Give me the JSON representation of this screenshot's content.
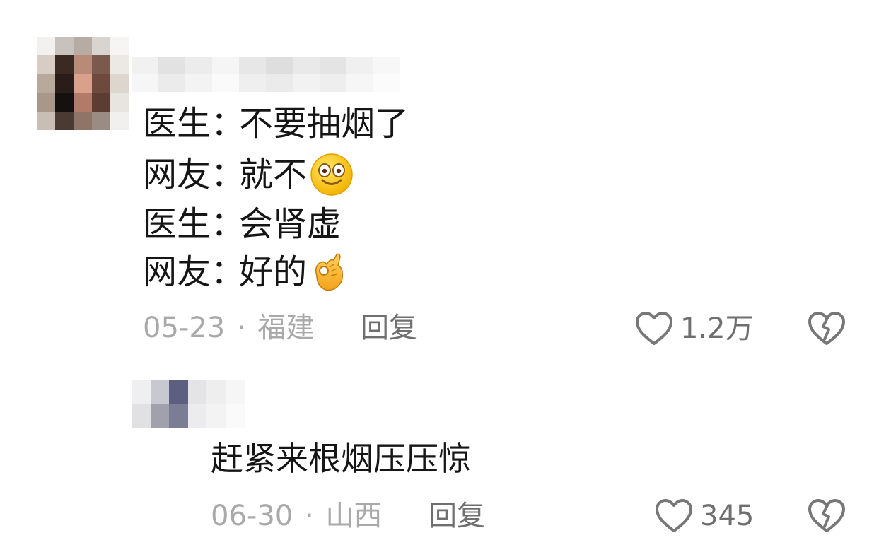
{
  "comment": {
    "lines": [
      {
        "speaker": "医生",
        "sep": "：",
        "text": "不要抽烟了",
        "emoji": ""
      },
      {
        "speaker": "网友",
        "sep": "：",
        "text": "就不",
        "emoji": "silly-face-emoji"
      },
      {
        "speaker": "医生",
        "sep": "：",
        "text": "会肾虚",
        "emoji": ""
      },
      {
        "speaker": "网友",
        "sep": "：",
        "text": "好的",
        "emoji": "ok-hand-emoji"
      }
    ],
    "date": "05-23",
    "dot": "·",
    "location": "福建",
    "reply_label": "回复",
    "likes": "1.2万",
    "icons": {
      "like": "heart-outline-icon",
      "dislike": "broken-heart-icon"
    }
  },
  "reply": {
    "text": "赶紧来根烟压压惊",
    "date": "06-30",
    "dot": "·",
    "location": "山西",
    "reply_label": "回复",
    "likes": "345",
    "icons": {
      "like": "heart-outline-icon",
      "dislike": "broken-heart-icon"
    }
  },
  "colors": {
    "text": "#151515",
    "meta": "#a9a9a9",
    "secondary": "#6f6f6f",
    "background": "#ffffff"
  }
}
